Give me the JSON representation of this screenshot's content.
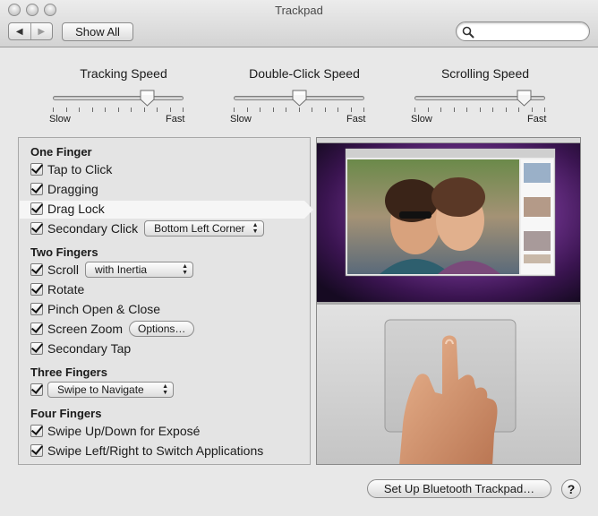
{
  "window": {
    "title": "Trackpad"
  },
  "toolbar": {
    "back_glyph": "◀",
    "forward_glyph": "▶",
    "show_all_label": "Show All",
    "search": {
      "value": "",
      "placeholder": ""
    }
  },
  "sliders": [
    {
      "title": "Tracking Speed",
      "min_label": "Slow",
      "max_label": "Fast",
      "value": 0.75
    },
    {
      "title": "Double-Click Speed",
      "min_label": "Slow",
      "max_label": "Fast",
      "value": 0.5
    },
    {
      "title": "Scrolling Speed",
      "min_label": "Slow",
      "max_label": "Fast",
      "value": 0.88
    }
  ],
  "gestures": {
    "one_finger": {
      "heading": "One Finger",
      "tap_to_click": "Tap to Click",
      "dragging": "Dragging",
      "drag_lock": "Drag Lock",
      "secondary_click": "Secondary Click",
      "secondary_click_option": "Bottom Left Corner"
    },
    "two_fingers": {
      "heading": "Two Fingers",
      "scroll": "Scroll",
      "scroll_option": "with Inertia",
      "rotate": "Rotate",
      "pinch": "Pinch Open & Close",
      "screen_zoom": "Screen Zoom",
      "screen_zoom_options": "Options…",
      "secondary_tap": "Secondary Tap"
    },
    "three_fingers": {
      "heading": "Three Fingers",
      "swipe_option": "Swipe to Navigate"
    },
    "four_fingers": {
      "heading": "Four Fingers",
      "swipe_up_down": "Swipe Up/Down for Exposé",
      "swipe_left_right": "Swipe Left/Right to Switch Applications"
    },
    "selected": "Drag Lock"
  },
  "footer": {
    "bluetooth_button": "Set Up Bluetooth Trackpad…",
    "help_label": "?"
  },
  "colors": {
    "accent": "#4a6ea9",
    "desktop_purple": "#5a2a6e",
    "trackpad_silver": "#c8c8c8"
  }
}
